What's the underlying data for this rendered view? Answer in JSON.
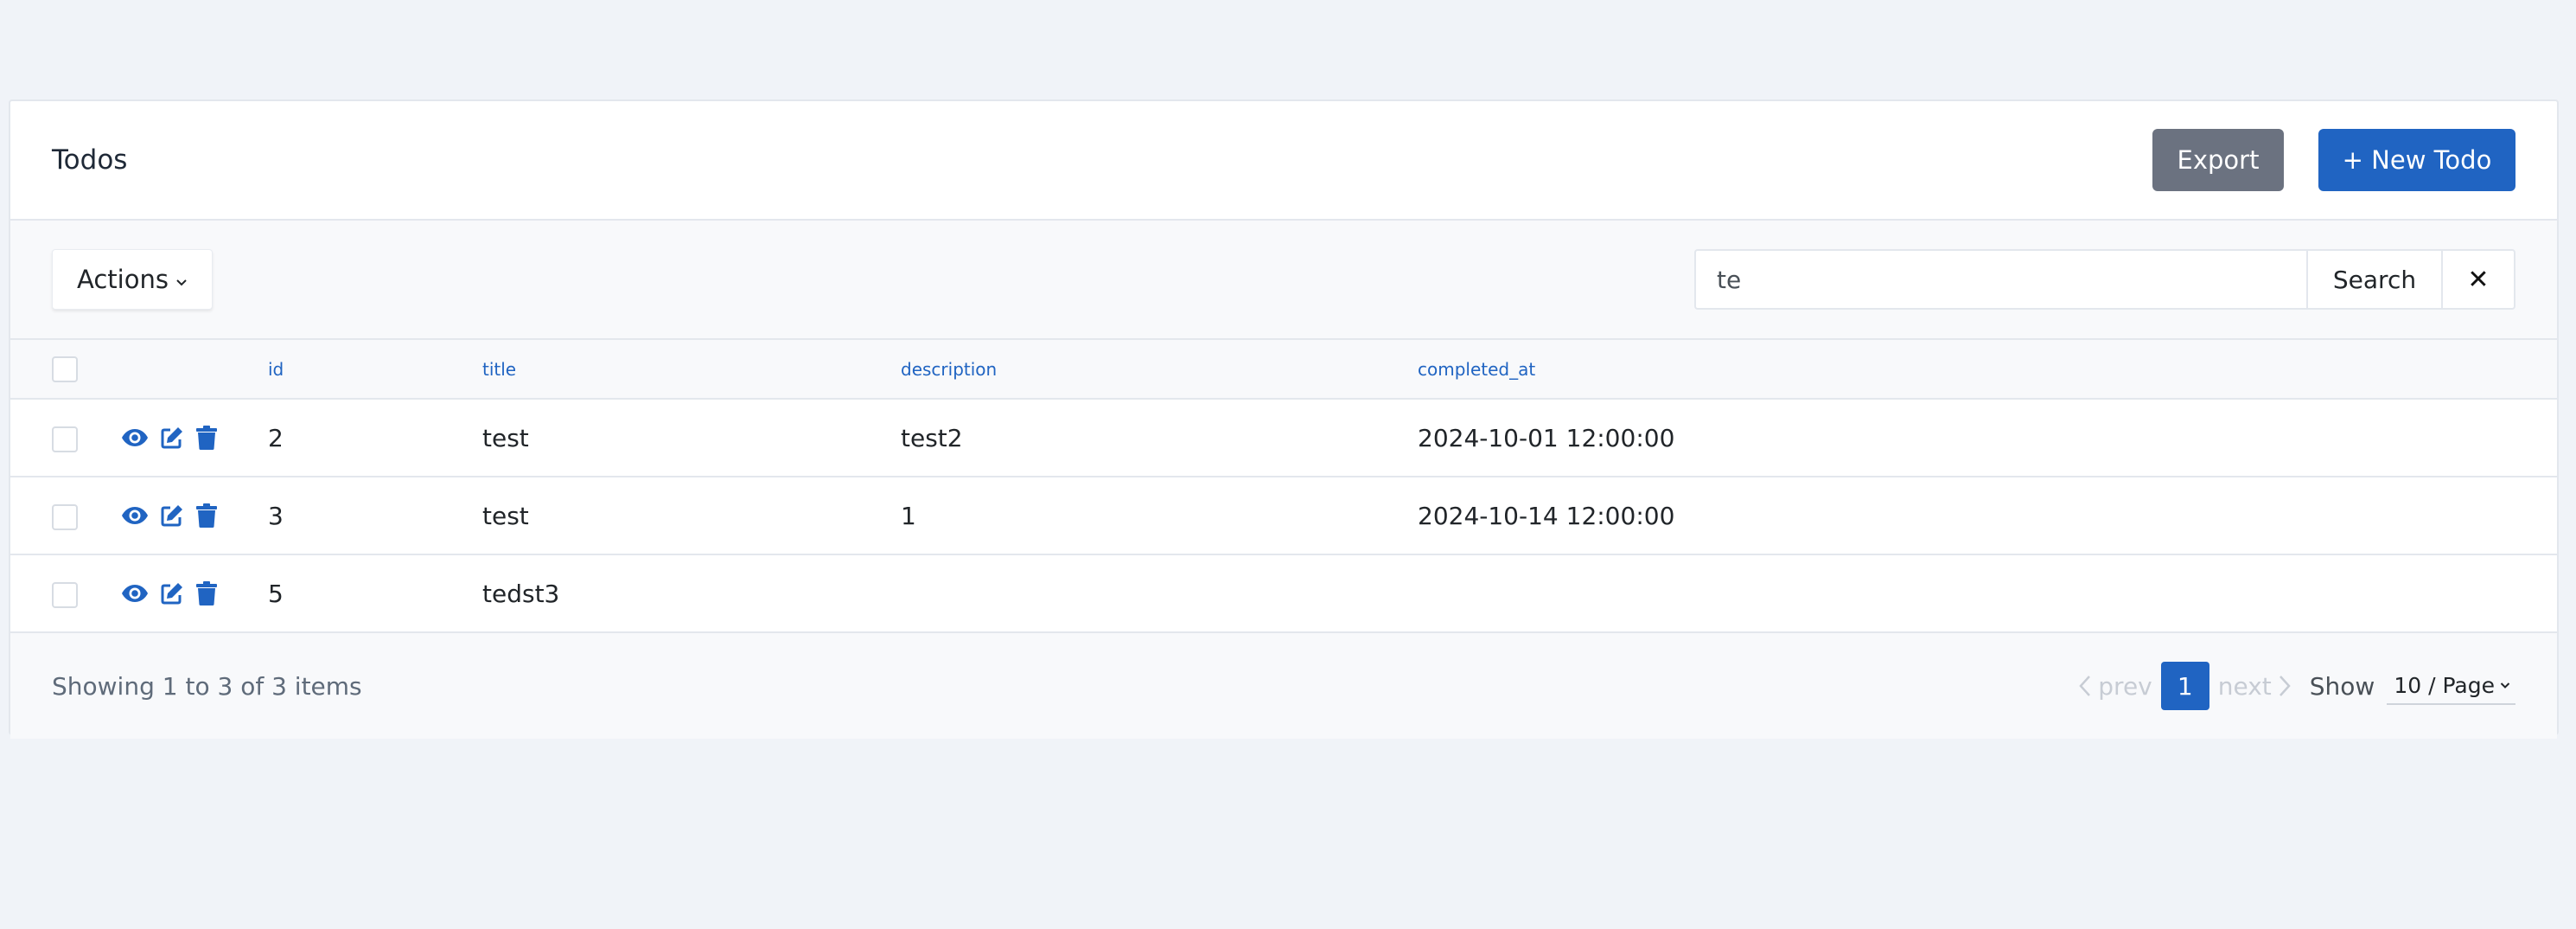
{
  "header": {
    "title": "Todos",
    "export_label": "Export",
    "new_label": "+ New Todo"
  },
  "toolbar": {
    "actions_label": "Actions",
    "search_value": "te",
    "search_button": "Search",
    "clear_button": "✕"
  },
  "table": {
    "columns": [
      "id",
      "title",
      "description",
      "completed_at"
    ],
    "rows": [
      {
        "id": "2",
        "title": "test",
        "description": "test2",
        "completed_at": "2024-10-01 12:00:00"
      },
      {
        "id": "3",
        "title": "test",
        "description": "1",
        "completed_at": "2024-10-14 12:00:00"
      },
      {
        "id": "5",
        "title": "tedst3",
        "description": "",
        "completed_at": ""
      }
    ],
    "row_icons": [
      "eye-icon",
      "edit-icon",
      "trash-icon"
    ]
  },
  "footer": {
    "showing": "Showing 1 to 3 of 3 items",
    "prev": "prev",
    "page": "1",
    "next": "next",
    "show": "Show",
    "per_page": "10 / Page"
  },
  "colors": {
    "primary": "#2064c2",
    "secondary": "#6b7280",
    "background": "#f0f3f8"
  }
}
